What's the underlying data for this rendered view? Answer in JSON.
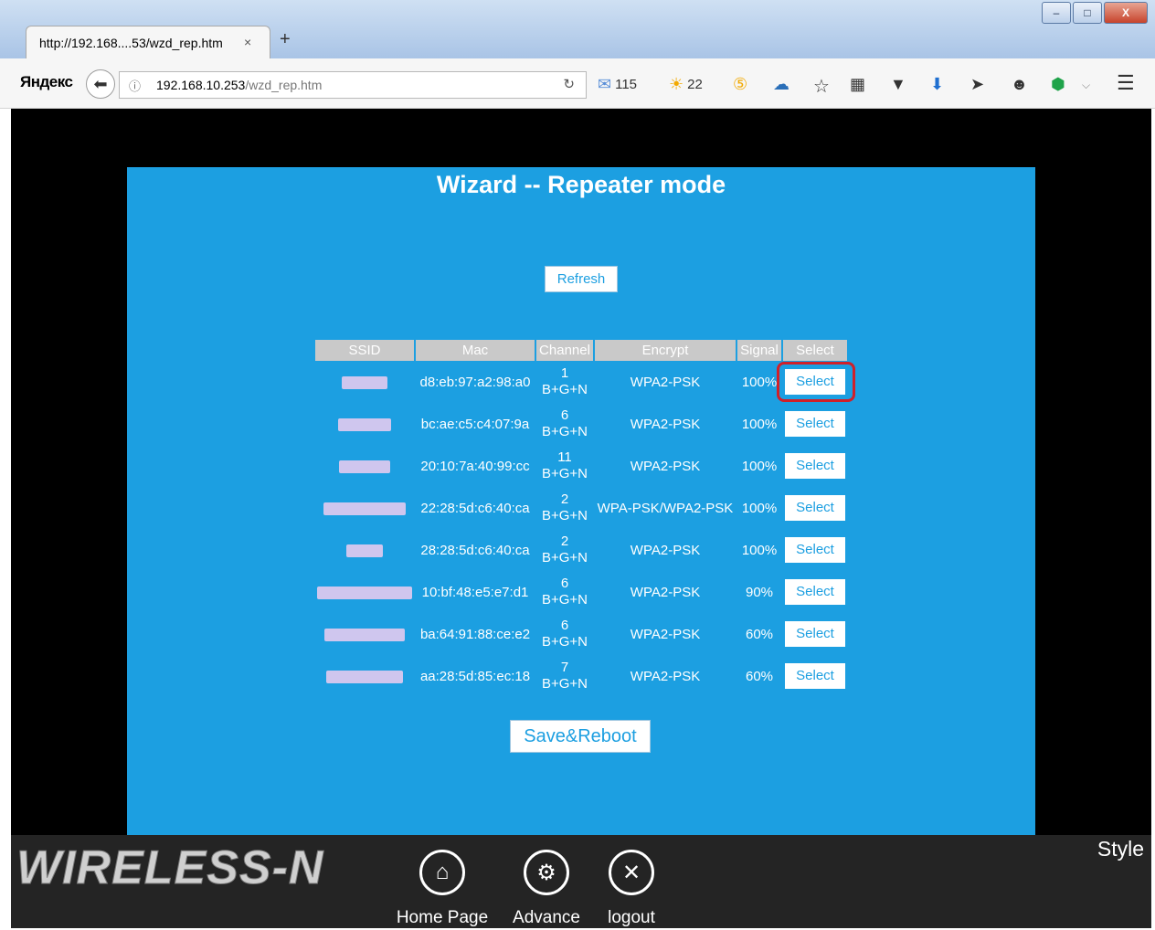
{
  "browser": {
    "tab_title": "http://192.168....53/wzd_rep.htm",
    "tab_close": "×",
    "new_tab": "+",
    "yandex_logo": "Яндекс",
    "url_host": "192.168.10.253",
    "url_path": "/wzd_rep.htm",
    "mail_count": "115",
    "weather_temp": "22",
    "window_buttons": {
      "minimize": "–",
      "maximize": "□",
      "close": "X"
    }
  },
  "wizard": {
    "title": "Wizard -- Repeater mode",
    "refresh_label": "Refresh",
    "columns": [
      "SSID",
      "Mac",
      "Channel",
      "Encrypt",
      "Signal",
      "Select"
    ],
    "networks": [
      {
        "mac": "d8:eb:97:a2:98:a0",
        "channel": "1",
        "band": "B+G+N",
        "encrypt": "WPA2-PSK",
        "signal": "100%",
        "select": "Select"
      },
      {
        "mac": "bc:ae:c5:c4:07:9a",
        "channel": "6",
        "band": "B+G+N",
        "encrypt": "WPA2-PSK",
        "signal": "100%",
        "select": "Select"
      },
      {
        "mac": "20:10:7a:40:99:cc",
        "channel": "11",
        "band": "B+G+N",
        "encrypt": "WPA2-PSK",
        "signal": "100%",
        "select": "Select"
      },
      {
        "mac": "22:28:5d:c6:40:ca",
        "channel": "2",
        "band": "B+G+N",
        "encrypt": "WPA-PSK/WPA2-PSK",
        "signal": "100%",
        "select": "Select"
      },
      {
        "mac": "28:28:5d:c6:40:ca",
        "channel": "2",
        "band": "B+G+N",
        "encrypt": "WPA2-PSK",
        "signal": "100%",
        "select": "Select"
      },
      {
        "mac": "10:bf:48:e5:e7:d1",
        "channel": "6",
        "band": "B+G+N",
        "encrypt": "WPA2-PSK",
        "signal": "90%",
        "select": "Select"
      },
      {
        "mac": "ba:64:91:88:ce:e2",
        "channel": "6",
        "band": "B+G+N",
        "encrypt": "WPA2-PSK",
        "signal": "60%",
        "select": "Select"
      },
      {
        "mac": "aa:28:5d:85:ec:18",
        "channel": "7",
        "band": "B+G+N",
        "encrypt": "WPA2-PSK",
        "signal": "60%",
        "select": "Select"
      }
    ],
    "save_label": "Save&Reboot"
  },
  "footer": {
    "brand": "WIRELESS-N",
    "style_label": "Style",
    "nav": [
      {
        "label": "Home Page",
        "icon": "home-icon"
      },
      {
        "label": "Advance",
        "icon": "gear-icon"
      },
      {
        "label": "logout",
        "icon": "close-icon"
      }
    ]
  },
  "colors": {
    "panel": "#1c9fe1",
    "highlight": "#d0202a",
    "footer": "#242424"
  }
}
